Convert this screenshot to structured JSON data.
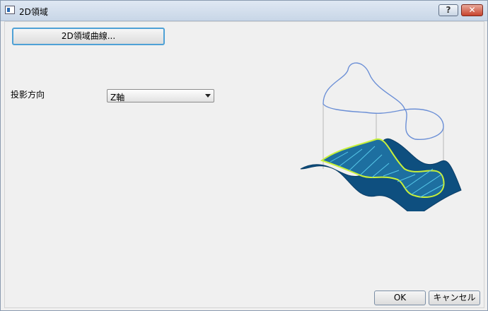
{
  "window": {
    "title": "2D領域"
  },
  "titlebar": {
    "help_label": "?",
    "close_label": "✕"
  },
  "main": {
    "curve_button_label": "2D領域曲線...",
    "projection": {
      "label": "投影方向",
      "selected": "Z軸"
    }
  },
  "footer": {
    "ok_label": "OK",
    "cancel_label": "キャンセル"
  },
  "colors": {
    "surface": "#0e4f7f",
    "outline_top": "#6b8fd6",
    "region_outline": "#c8f03a",
    "hatch": "#58c8e8"
  }
}
